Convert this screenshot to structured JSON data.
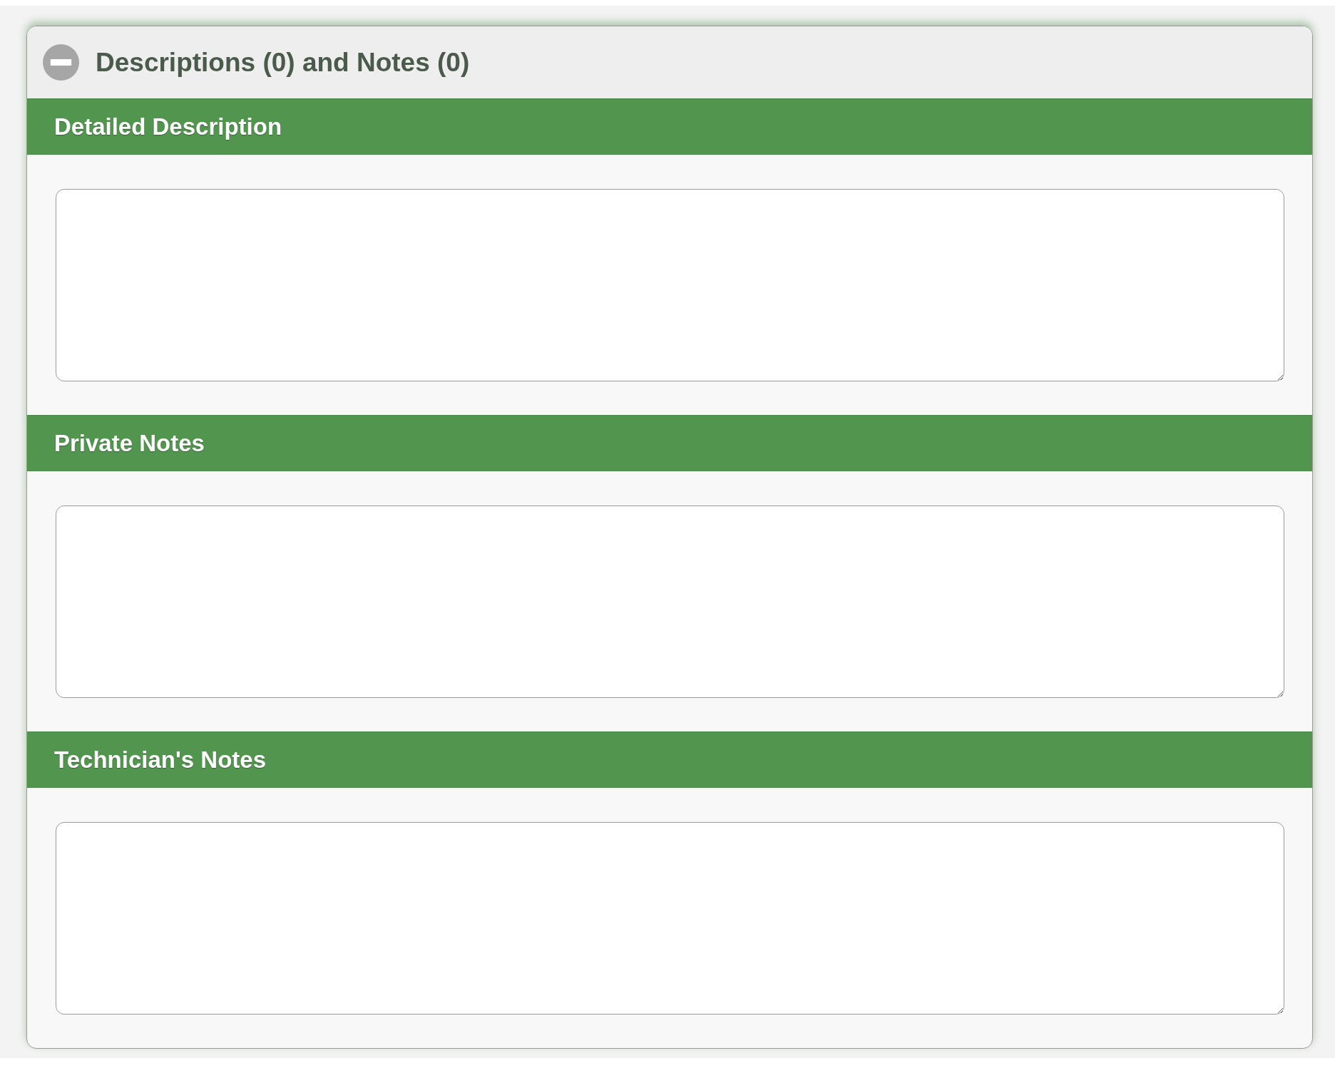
{
  "panel": {
    "title": "Descriptions (0) and Notes (0)",
    "expanded": true
  },
  "sections": [
    {
      "heading": "Detailed Description"
    },
    {
      "heading": "Private Notes"
    },
    {
      "heading": "Technician's Notes"
    }
  ]
}
